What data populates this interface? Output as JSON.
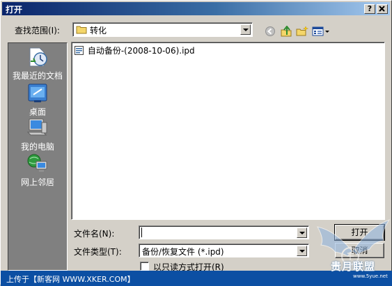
{
  "window": {
    "title": "打开",
    "help_btn": "?",
    "close_btn": "X"
  },
  "lookin": {
    "label": "查找范围(I):",
    "value": "转化"
  },
  "places": [
    {
      "label": "我最近的文档",
      "icon": "recent-documents-icon"
    },
    {
      "label": "桌面",
      "icon": "desktop-icon"
    },
    {
      "label": "我的电脑",
      "icon": "my-computer-icon"
    },
    {
      "label": "网上邻居",
      "icon": "network-places-icon"
    }
  ],
  "files": [
    {
      "name": "自动备份-(2008-10-06).ipd",
      "icon": "document-icon"
    }
  ],
  "filename": {
    "label": "文件名(N):",
    "value": ""
  },
  "filetype": {
    "label": "文件类型(T):",
    "value": "备份/恢复文件 (*.ipd)"
  },
  "readonly": {
    "label": "以只读方式打开(R)",
    "checked": false
  },
  "buttons": {
    "open": "打开",
    "cancel": "取消"
  },
  "footer": {
    "text": "上传于【新客网 WWW.XKER.COM】"
  },
  "watermark": {
    "text": "贵月联盟",
    "url": "www.5yue.net"
  }
}
